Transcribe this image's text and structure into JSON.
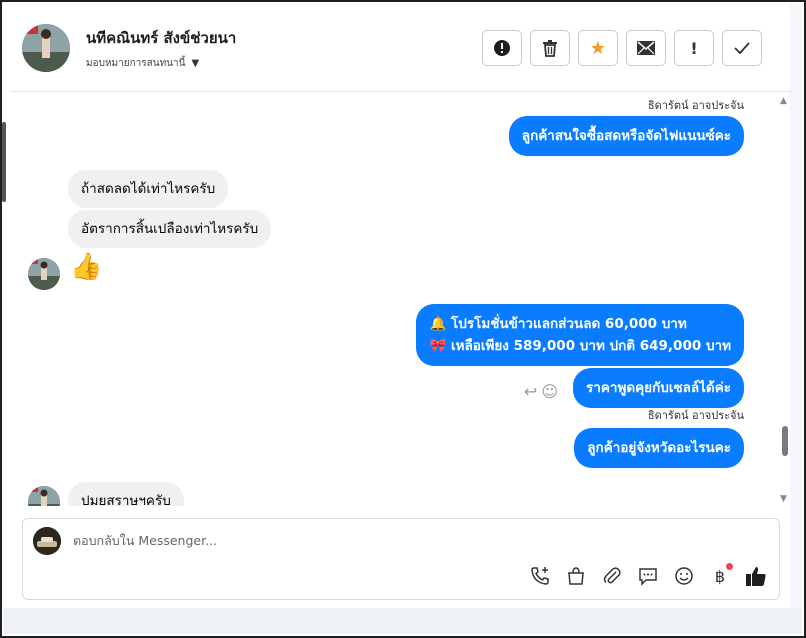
{
  "contact": {
    "name": "นทีคณินทร์ สังข์ช่วยนา",
    "assigned": "มอบหมายการสนทนานี้"
  },
  "messages": {
    "sender1": "ธิดารัตน์ อาจประจัน",
    "out1": "ลูกค้าสนใจซื้อสดหรือจัดไฟแนนซ์คะ",
    "in1": "ถ้าสดลดได้เท่าไหรครับ",
    "in2": "อัตราการสิ้นเปลืองเท่าไหรครับ",
    "in3_emoji": "👍",
    "out2_line1": "🔔 โปรโมชั่นข้าวแลกส่วนลด 60,000 บาท",
    "out2_line2": "🎀 เหลือเพียง 589,000 บาท ปกติ 649,000 บาท",
    "out3": "ราคาพูดคุยกับเซลล์ได้ค่ะ",
    "sender2": "ธิดารัตน์ อาจประจัน",
    "out4": "ลูกค้าอยู่จังหวัดอะไรนคะ",
    "in4": "ปมยสราษฯครับ"
  },
  "composer": {
    "placeholder": "ตอบกลับใน Messenger..."
  },
  "colors": {
    "accent": "#0a7cff",
    "star": "#f59a23",
    "notify_dot": "#e8475a"
  },
  "icons": [
    "info-icon",
    "trash-icon",
    "star-icon",
    "mail-icon",
    "exclamation-icon",
    "check-icon",
    "call-add-icon",
    "shop-bag-icon",
    "paperclip-icon",
    "chat-icon",
    "emoji-icon",
    "baht-icon",
    "thumbs-up-icon"
  ]
}
